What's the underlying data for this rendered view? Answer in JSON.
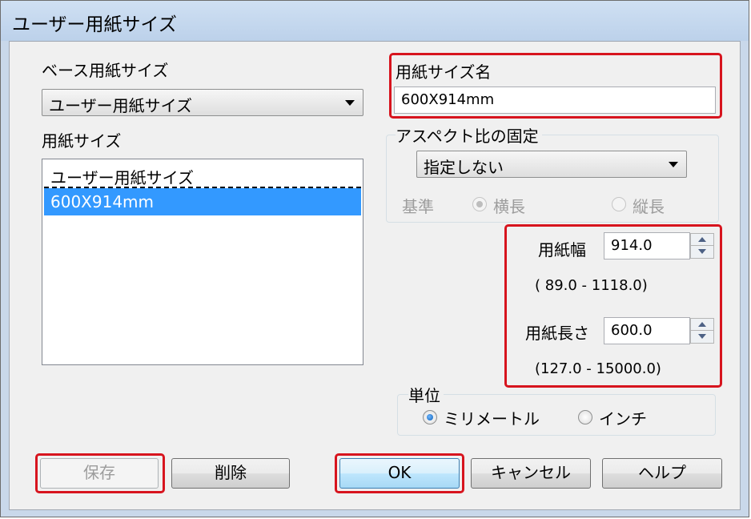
{
  "window": {
    "title": "ユーザー用紙サイズ"
  },
  "base_paper": {
    "label": "ベース用紙サイズ",
    "selected": "ユーザー用紙サイズ"
  },
  "paper_size_list": {
    "label": "用紙サイズ",
    "items": [
      {
        "label": "ユーザー用紙サイズ"
      },
      {
        "label": "600X914mm"
      }
    ]
  },
  "paper_name": {
    "label": "用紙サイズ名",
    "value": "600X914mm"
  },
  "aspect": {
    "label": "アスペクト比の固定",
    "selected": "指定しない",
    "reference_label": "基準",
    "options": [
      {
        "label": "横長"
      },
      {
        "label": "縦長"
      }
    ]
  },
  "dimensions": {
    "width": {
      "label": "用紙幅",
      "value": "914.0",
      "range": "( 89.0 - 1118.0)"
    },
    "length": {
      "label": "用紙長さ",
      "value": "600.0",
      "range": "(127.0 - 15000.0)"
    }
  },
  "unit": {
    "label": "単位",
    "options": [
      {
        "label": "ミリメートル"
      },
      {
        "label": "インチ"
      }
    ]
  },
  "buttons": {
    "save": "保存",
    "delete": "削除",
    "ok": "OK",
    "cancel": "キャンセル",
    "help": "ヘルプ"
  },
  "colors": {
    "highlight": "#d7141e",
    "selection": "#3399ff",
    "title_bar": "#c9d8ea"
  }
}
